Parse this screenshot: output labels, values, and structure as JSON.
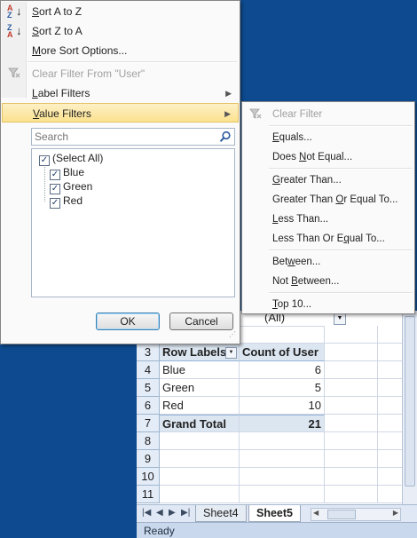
{
  "main_menu": {
    "sort_az": {
      "prefix": "",
      "key": "S",
      "rest": "ort A to Z"
    },
    "sort_za": {
      "prefix": "",
      "key": "S",
      "rest": "ort Z to A"
    },
    "more_sort": {
      "prefix": "",
      "key": "M",
      "rest": "ore Sort Options..."
    },
    "clear_filter": "Clear Filter From \"User\"",
    "label_filters": {
      "prefix": "",
      "key": "L",
      "rest": "abel Filters"
    },
    "value_filters": {
      "prefix": "",
      "key": "V",
      "rest": "alue Filters"
    },
    "search_placeholder": "Search",
    "list_items": [
      "(Select All)",
      "Blue",
      "Green",
      "Red"
    ],
    "ok_label": "OK",
    "cancel_label": "Cancel"
  },
  "value_filters_menu": {
    "clear_filter": "Clear Filter",
    "equals": {
      "prefix": "",
      "key": "E",
      "rest": "quals..."
    },
    "not_equal": {
      "prefix": "Does ",
      "key": "N",
      "rest": "ot Equal..."
    },
    "greater": {
      "prefix": "",
      "key": "G",
      "rest": "reater Than..."
    },
    "greater_equal": {
      "prefix": "Greater Than ",
      "key": "O",
      "rest": "r Equal To..."
    },
    "less": {
      "prefix": "",
      "key": "L",
      "rest": "ess Than..."
    },
    "less_equal": {
      "prefix": "Less Than Or E",
      "key": "q",
      "rest": "ual To..."
    },
    "between": {
      "prefix": "Bet",
      "key": "w",
      "rest": "een..."
    },
    "not_between": {
      "prefix": "Not ",
      "key": "B",
      "rest": "etween..."
    },
    "top10": {
      "prefix": "",
      "key": "T",
      "rest": "op 10..."
    }
  },
  "sheet": {
    "filter_value": "(All)",
    "row_numbers": [
      "3",
      "4",
      "5",
      "6",
      "7",
      "8",
      "9",
      "10",
      "11"
    ],
    "header": {
      "row_labels": "Row Labels",
      "count": "Count of User"
    },
    "rows": [
      {
        "label": "Blue",
        "value": "6"
      },
      {
        "label": "Green",
        "value": "5"
      },
      {
        "label": "Red",
        "value": "10"
      }
    ],
    "total": {
      "label": "Grand Total",
      "value": "21"
    },
    "tabs": [
      "Sheet4",
      "Sheet5"
    ],
    "status": "Ready"
  },
  "colors": {
    "accent_highlight": "#fbe28e",
    "window_bg": "#0d4a8f",
    "pivot_header": "#dce6f1"
  }
}
